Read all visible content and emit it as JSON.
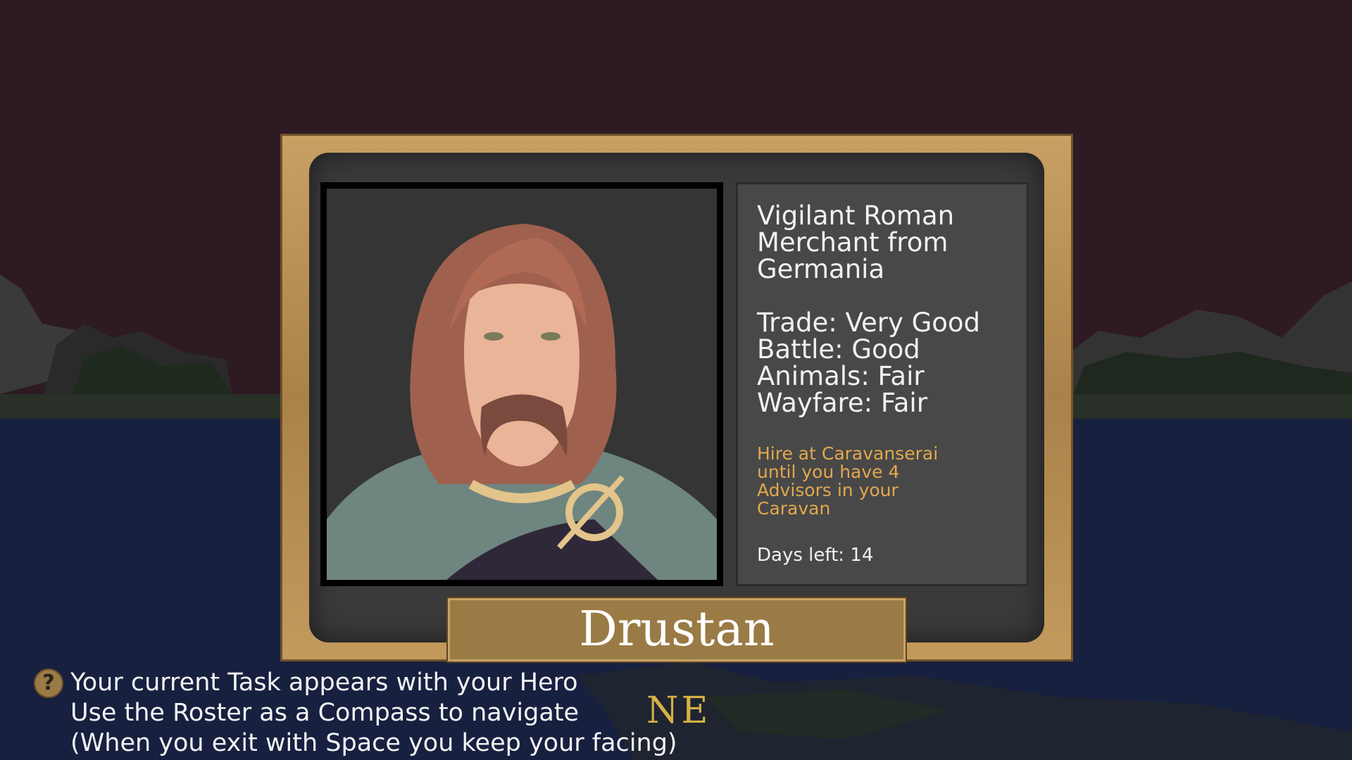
{
  "advisor": {
    "title_lines": [
      "Vigilant Roman",
      "Merchant from",
      "Germania"
    ],
    "stats": [
      "Trade: Very Good",
      "Battle: Good",
      "Animals: Fair",
      "Wayfare: Fair"
    ],
    "hire_lines": [
      "Hire at Caravanserai",
      "until you have 4",
      "Advisors in your",
      "Caravan"
    ],
    "days_left": "Days left: 14",
    "name": "Drustan"
  },
  "hints": {
    "lines": [
      "Your current Task appears with your Hero",
      "Use the Roster as a Compass to navigate",
      "(When you exit with Space you keep your facing)"
    ],
    "help_icon": "question-mark-icon"
  },
  "compass": {
    "heading": "NE"
  },
  "colors": {
    "sky": "#2e1a22",
    "sea": "#182040",
    "frame_gold": "#b8904f",
    "hire_text": "#e2a84e",
    "compass_text": "#d6b044"
  }
}
